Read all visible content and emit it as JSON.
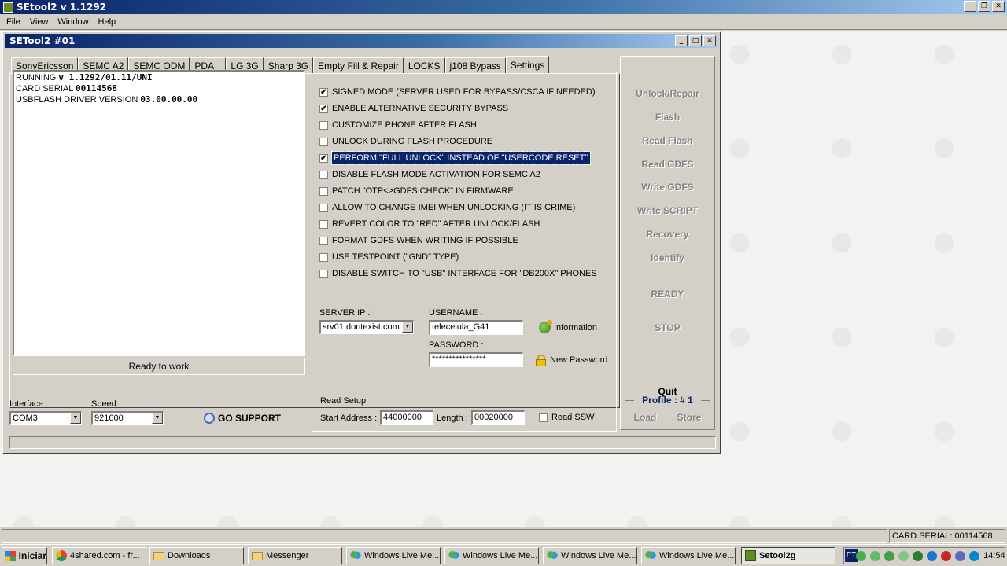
{
  "app": {
    "title": "SEtool2 v 1.1292",
    "menu": [
      "File",
      "View",
      "Window",
      "Help"
    ]
  },
  "child": {
    "title": "SETool2 #01"
  },
  "tabs": [
    {
      "label": "SonyEricsson"
    },
    {
      "label": "SEMC A2"
    },
    {
      "label": "SEMC ODM"
    },
    {
      "label": "PDA"
    },
    {
      "label": "LG 3G"
    },
    {
      "label": "Sharp 3G"
    },
    {
      "label": "Empty Fill & Repair"
    },
    {
      "label": "LOCKS"
    },
    {
      "label": "j108 Bypass"
    },
    {
      "label": "Settings"
    }
  ],
  "log": {
    "line1_prefix": "RUNNING ",
    "line1_value": "v 1.1292/01.11/UNI",
    "line2_prefix": "CARD SERIAL ",
    "line2_value": "00114568",
    "line3_prefix": "USBFLASH DRIVER VERSION ",
    "line3_value": "03.00.00.00"
  },
  "status_text": "Ready to work",
  "options": [
    {
      "label": "SIGNED MODE (SERVER USED FOR BYPASS/CSCA IF NEEDED)",
      "checked": "✔"
    },
    {
      "label": "ENABLE ALTERNATIVE SECURITY BYPASS",
      "checked": "✔"
    },
    {
      "label": "CUSTOMIZE PHONE AFTER FLASH",
      "checked": ""
    },
    {
      "label": "UNLOCK DURING FLASH PROCEDURE",
      "checked": ""
    },
    {
      "label": "PERFORM \"FULL UNLOCK\" INSTEAD OF \"USERCODE RESET\"",
      "checked": "✔"
    },
    {
      "label": "DISABLE FLASH MODE ACTIVATION FOR SEMC A2",
      "checked": ""
    },
    {
      "label": "PATCH \"OTP<>GDFS CHECK\" IN FIRMWARE",
      "checked": ""
    },
    {
      "label": "ALLOW TO CHANGE IMEI WHEN UNLOCKING (IT IS CRIME)",
      "checked": ""
    },
    {
      "label": "REVERT COLOR TO \"RED\" AFTER UNLOCK/FLASH",
      "checked": ""
    },
    {
      "label": "FORMAT GDFS WHEN WRITING IF POSSIBLE",
      "checked": ""
    },
    {
      "label": "USE TESTPOINT (\"GND\" TYPE)",
      "checked": ""
    },
    {
      "label": "DISABLE SWITCH TO \"USB\" INTERFACE FOR \"DB200X\" PHONES",
      "checked": ""
    }
  ],
  "server": {
    "ip_label": "SERVER IP :",
    "ip_value": "srv01.dontexist.com",
    "username_label": "USERNAME :",
    "username_value": "telecelula_G41",
    "password_label": "PASSWORD :",
    "password_value": "****************",
    "information_label": "Information",
    "new_password_label": "New Password"
  },
  "side_buttons": {
    "unlock_repair": "Unlock/Repair",
    "flash": "Flash",
    "read_flash": "Read Flash",
    "read_gdfs": "Read GDFS",
    "write_gdfs": "Write GDFS",
    "write_script": "Write SCRIPT",
    "recovery": "Recovery",
    "identify": "Identify",
    "ready": "READY",
    "stop": "STOP",
    "quit": "Quit",
    "profile": "Profile : # 1",
    "load": "Load",
    "store": "Store"
  },
  "bottom": {
    "interface_label": "Interface :",
    "interface_value": "COM3",
    "speed_label": "Speed :",
    "speed_value": "921600",
    "go_support": "GO SUPPORT",
    "read_setup_title": "Read Setup",
    "start_address_label": "Start Address :",
    "start_address_value": "44000000",
    "length_label": "Length :",
    "length_value": "00020000",
    "read_ssw_label": "Read SSW"
  },
  "app_status": {
    "card_serial": "CARD SERIAL: 00114568"
  },
  "taskbar": {
    "start": "Iniciar",
    "items": [
      {
        "label": "4shared.com - fr..."
      },
      {
        "label": "Downloads"
      },
      {
        "label": "Messenger"
      },
      {
        "label": "Windows Live Me..."
      },
      {
        "label": "Windows Live Me..."
      },
      {
        "label": "Windows Live Me..."
      },
      {
        "label": "Windows Live Me..."
      },
      {
        "label": "Setool2g"
      }
    ],
    "language": "PT",
    "tray_chevron": "«",
    "clock": "14:54"
  },
  "colors": {
    "title_active": "#0a246a",
    "window_bg": "#d4d0c8",
    "profile_text": "#0a246a"
  }
}
